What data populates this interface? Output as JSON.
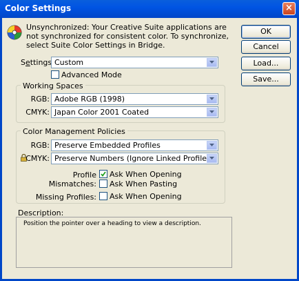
{
  "window": {
    "title": "Color Settings",
    "close_glyph": "×"
  },
  "sync": {
    "icon": "color-sync-icon",
    "message": "Unsynchronized: Your Creative Suite applications are not synchronized for consistent color. To synchronize, select Suite Color Settings in Bridge."
  },
  "settings": {
    "label_prefix": "S",
    "label_underlined": "e",
    "label_suffix": "ttings:",
    "value": "Custom",
    "advanced_mode_label": "Advanced Mode",
    "advanced_mode_checked": false
  },
  "working_spaces": {
    "title": "Working Spaces",
    "rgb_label": "RGB:",
    "rgb_value": "Adobe RGB (1998)",
    "cmyk_label": "CMYK:",
    "cmyk_value": "Japan Color 2001 Coated"
  },
  "policies": {
    "title": "Color Management Policies",
    "rgb_label": "RGB:",
    "rgb_value": "Preserve Embedded Profiles",
    "cmyk_label": "CMYK:",
    "cmyk_value": "Preserve Numbers (Ignore Linked Profiles)",
    "profile_mismatches_label": "Profile Mismatches:",
    "ask_when_opening_label": "Ask When Opening",
    "ask_when_opening_checked": true,
    "ask_when_pasting_label": "Ask When Pasting",
    "ask_when_pasting_checked": false,
    "missing_profiles_label": "Missing Profiles:",
    "missing_ask_when_opening_label": "Ask When Opening",
    "missing_ask_when_opening_checked": false
  },
  "description": {
    "label": "Description:",
    "text": "Position the pointer over a heading to view a description."
  },
  "buttons": {
    "ok": "OK",
    "cancel": "Cancel",
    "load": "Load...",
    "save": "Save..."
  }
}
